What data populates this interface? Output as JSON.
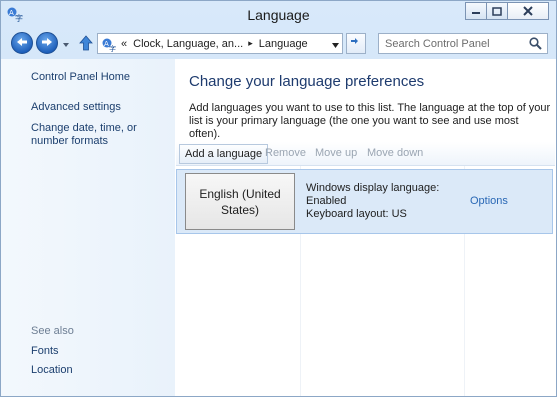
{
  "window": {
    "title": "Language",
    "controls": [
      "minimize-icon",
      "maximize-icon",
      "close-icon"
    ]
  },
  "address": {
    "overflow": "«",
    "crumb1": "Clock, Language, an...",
    "crumb2": "Language",
    "search_placeholder": "Search Control Panel"
  },
  "sidebar": {
    "home": "Control Panel Home",
    "advanced": "Advanced settings",
    "date_formats": "Change date, time, or number formats",
    "see_also": "See also",
    "fonts": "Fonts",
    "location": "Location"
  },
  "main": {
    "heading": "Change your language preferences",
    "description": "Add languages you want to use to this list. The language at the top of your list is your primary language (the one you want to see and use most often).",
    "toolbar": {
      "add": "Add a language",
      "remove": "Remove",
      "move_up": "Move up",
      "move_down": "Move down"
    },
    "languages": [
      {
        "name": "English (United States)",
        "display_label": "Windows display language:",
        "display_value": "Enabled",
        "keyboard": "Keyboard layout: US",
        "options": "Options"
      }
    ]
  },
  "colors": {
    "accent": "#1e3b6e",
    "link": "#1c3f6e",
    "selection": "#dbe9f8"
  }
}
